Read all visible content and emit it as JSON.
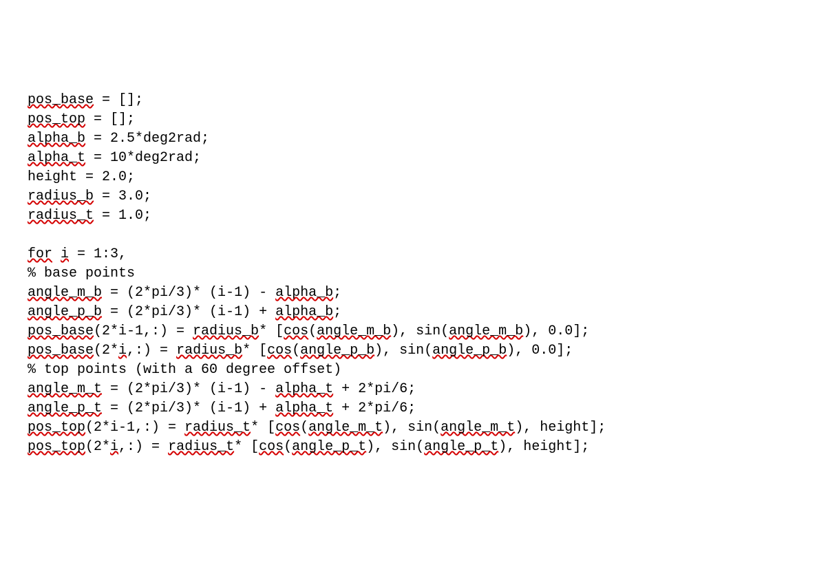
{
  "code": {
    "lines": [
      {
        "segments": [
          {
            "t": "pos_base",
            "u": true
          },
          {
            "t": " = [];",
            "u": false
          }
        ]
      },
      {
        "segments": [
          {
            "t": "pos_top",
            "u": true
          },
          {
            "t": " = [];",
            "u": false
          }
        ]
      },
      {
        "segments": [
          {
            "t": "alpha_b",
            "u": true
          },
          {
            "t": " = 2.5*deg2rad;",
            "u": false
          }
        ]
      },
      {
        "segments": [
          {
            "t": "alpha_t",
            "u": true
          },
          {
            "t": " = 10*deg2rad;",
            "u": false
          }
        ]
      },
      {
        "segments": [
          {
            "t": "height = 2.0;",
            "u": false
          }
        ]
      },
      {
        "segments": [
          {
            "t": "radius_b",
            "u": true
          },
          {
            "t": " = 3.0;",
            "u": false
          }
        ]
      },
      {
        "segments": [
          {
            "t": "radius_t",
            "u": true
          },
          {
            "t": " = 1.0;",
            "u": false
          }
        ]
      },
      {
        "segments": [
          {
            "t": "",
            "u": false
          }
        ]
      },
      {
        "segments": [
          {
            "t": "for",
            "u": true
          },
          {
            "t": " ",
            "u": false
          },
          {
            "t": "i",
            "u": true
          },
          {
            "t": " = 1:3,",
            "u": false
          }
        ]
      },
      {
        "segments": [
          {
            "t": "% base points",
            "u": false
          }
        ]
      },
      {
        "segments": [
          {
            "t": "angle_m_b",
            "u": true
          },
          {
            "t": " = (2*pi/3)* (i-1) - ",
            "u": false
          },
          {
            "t": "alpha_b",
            "u": true
          },
          {
            "t": ";",
            "u": false
          }
        ]
      },
      {
        "segments": [
          {
            "t": "angle_p_b",
            "u": true
          },
          {
            "t": " = (2*pi/3)* (i-1) + ",
            "u": false
          },
          {
            "t": "alpha_b",
            "u": true
          },
          {
            "t": ";",
            "u": false
          }
        ]
      },
      {
        "segments": [
          {
            "t": "pos_base",
            "u": true
          },
          {
            "t": "(2*i-1,:) = ",
            "u": false
          },
          {
            "t": "radius_b",
            "u": true
          },
          {
            "t": "* [",
            "u": false
          },
          {
            "t": "cos",
            "u": true
          },
          {
            "t": "(",
            "u": false
          },
          {
            "t": "angle_m_b",
            "u": true
          },
          {
            "t": "), sin(",
            "u": false
          },
          {
            "t": "angle_m_b",
            "u": true
          },
          {
            "t": "), 0.0];",
            "u": false
          }
        ]
      },
      {
        "segments": [
          {
            "t": "pos_base",
            "u": true
          },
          {
            "t": "(2*",
            "u": false
          },
          {
            "t": "i",
            "u": true
          },
          {
            "t": ",:) = ",
            "u": false
          },
          {
            "t": "radius_b",
            "u": true
          },
          {
            "t": "* [",
            "u": false
          },
          {
            "t": "cos",
            "u": true
          },
          {
            "t": "(",
            "u": false
          },
          {
            "t": "angle_p_b",
            "u": true
          },
          {
            "t": "), sin(",
            "u": false
          },
          {
            "t": "angle_p_b",
            "u": true
          },
          {
            "t": "), 0.0];",
            "u": false
          }
        ]
      },
      {
        "segments": [
          {
            "t": "% top points (with a 60 degree offset)",
            "u": false
          }
        ]
      },
      {
        "segments": [
          {
            "t": "angle_m_t",
            "u": true
          },
          {
            "t": " = (2*pi/3)* (i-1) - ",
            "u": false
          },
          {
            "t": "alpha_t",
            "u": true
          },
          {
            "t": " + 2*pi/6;",
            "u": false
          }
        ]
      },
      {
        "segments": [
          {
            "t": "angle_p_t",
            "u": true
          },
          {
            "t": " = (2*pi/3)* (i-1) + ",
            "u": false
          },
          {
            "t": "alpha_t",
            "u": true
          },
          {
            "t": " + 2*pi/6;",
            "u": false
          }
        ]
      },
      {
        "segments": [
          {
            "t": "pos_top",
            "u": true
          },
          {
            "t": "(2*i-1,:) = ",
            "u": false
          },
          {
            "t": "radius_t",
            "u": true
          },
          {
            "t": "* [",
            "u": false
          },
          {
            "t": "cos",
            "u": true
          },
          {
            "t": "(",
            "u": false
          },
          {
            "t": "angle_m_t",
            "u": true
          },
          {
            "t": "), sin(",
            "u": false
          },
          {
            "t": "angle_m_t",
            "u": true
          },
          {
            "t": "), height];",
            "u": false
          }
        ]
      },
      {
        "segments": [
          {
            "t": "pos_top",
            "u": true
          },
          {
            "t": "(2*",
            "u": false
          },
          {
            "t": "i",
            "u": true
          },
          {
            "t": ",:) = ",
            "u": false
          },
          {
            "t": "radius_t",
            "u": true
          },
          {
            "t": "* [",
            "u": false
          },
          {
            "t": "cos",
            "u": true
          },
          {
            "t": "(",
            "u": false
          },
          {
            "t": "angle_p_t",
            "u": true
          },
          {
            "t": "), sin(",
            "u": false
          },
          {
            "t": "angle_p_t",
            "u": true
          },
          {
            "t": "), height];",
            "u": false
          }
        ]
      }
    ]
  }
}
